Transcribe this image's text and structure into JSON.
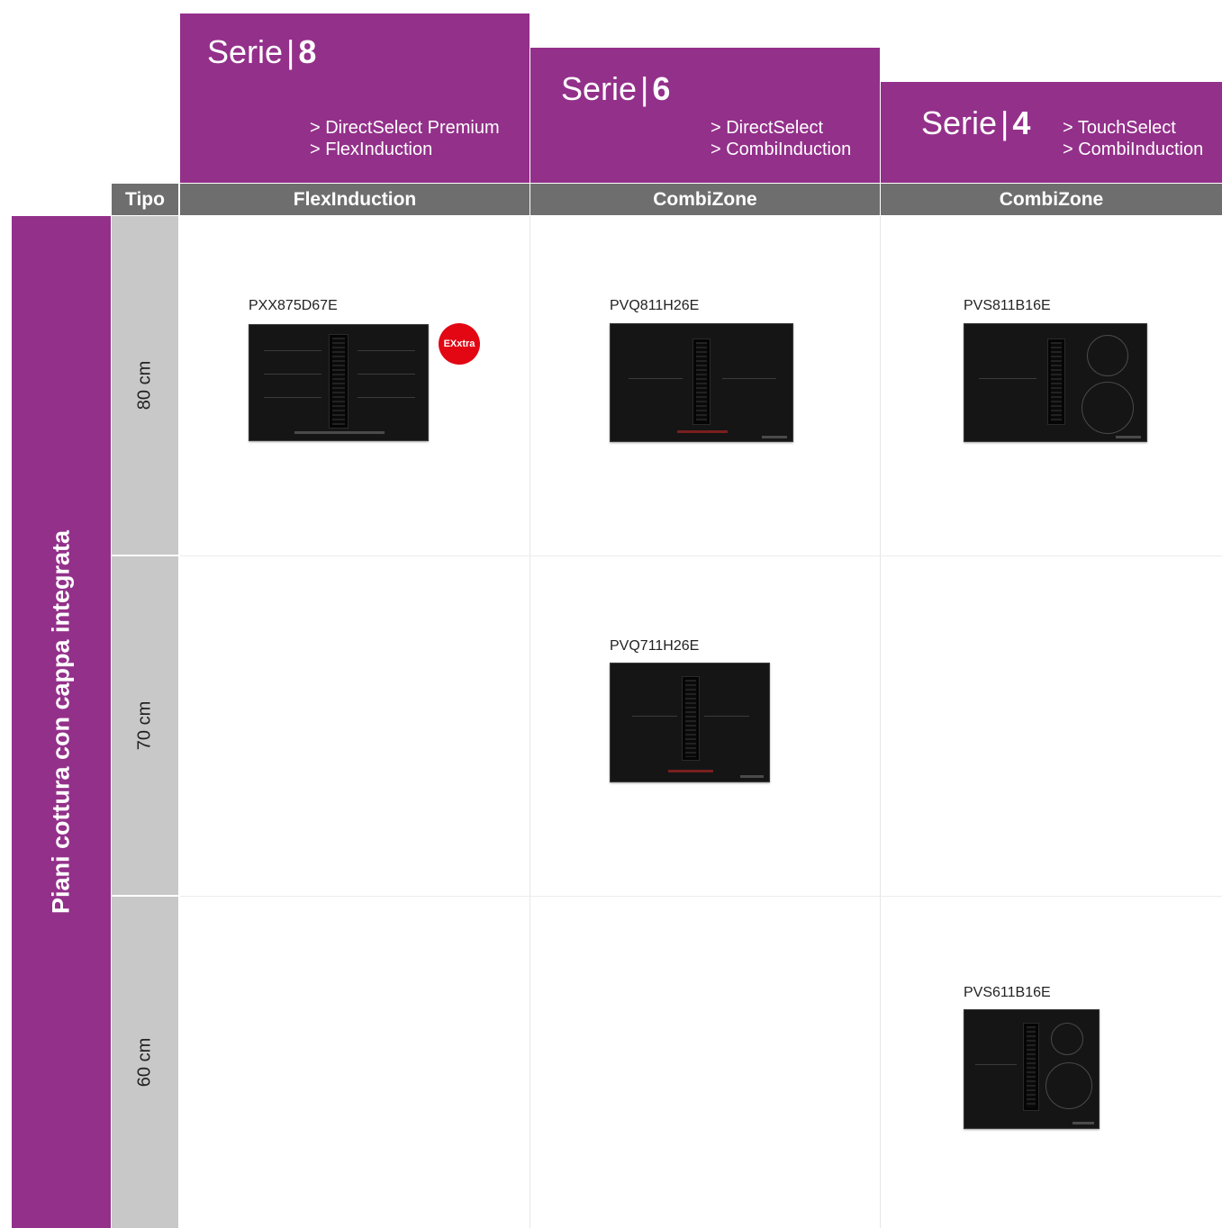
{
  "series": [
    {
      "word": "Serie",
      "separator": "|",
      "number": "8",
      "features": [
        "> DirectSelect Premium",
        "> FlexInduction"
      ],
      "type_header": "FlexInduction"
    },
    {
      "word": "Serie",
      "separator": "|",
      "number": "6",
      "features": [
        "> DirectSelect",
        "> CombiInduction"
      ],
      "type_header": "CombiZone"
    },
    {
      "word": "Serie",
      "separator": "|",
      "number": "4",
      "features": [
        "> TouchSelect",
        "> CombiInduction"
      ],
      "type_header": "CombiZone"
    }
  ],
  "tipo_label": "Tipo",
  "category_label": "Piani cottura con cappa integrata",
  "sizes": [
    "80 cm",
    "70 cm",
    "60 cm"
  ],
  "products": {
    "pxx875d67e": "PXX875D67E",
    "pvq811h26e": "PVQ811H26E",
    "pvs811b16e": "PVS811B16E",
    "pvq711h26e": "PVQ711H26E",
    "pvs611b16e": "PVS611B16E"
  },
  "badge_text": "EXxtra",
  "colors": {
    "brand_purple": "#93308a",
    "header_grey": "#6e6e6e",
    "size_grey": "#c8c8c8",
    "badge_red": "#e30613"
  }
}
